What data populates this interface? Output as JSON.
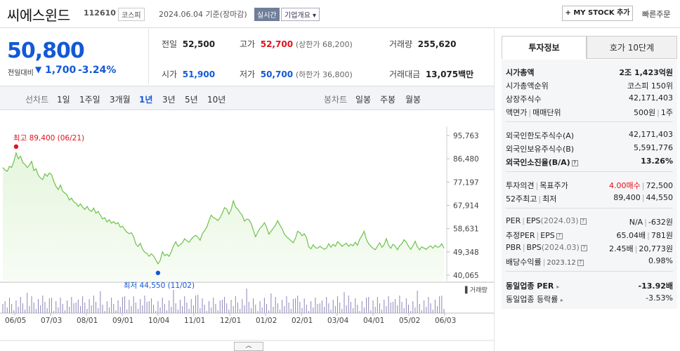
{
  "header": {
    "name": "씨에스윈드",
    "code": "112610",
    "market": "코스피",
    "date": "2024.06.04 기준(장마감)",
    "realtime": "실시간",
    "overview": "기업개요",
    "mystock": "+ MY STOCK 추가",
    "quick_order": "빠른주문"
  },
  "summary": {
    "price": "50,800",
    "diff_label": "전일대비",
    "diff_value": "1,700",
    "diff_pct": "-3.24%",
    "prev_close_label": "전일",
    "prev_close": "52,500",
    "high_label": "고가",
    "high": "52,700",
    "upper_limit": "(상한가 68,200)",
    "volume_label": "거래량",
    "volume": "255,620",
    "open_label": "시가",
    "open": "51,900",
    "low_label": "저가",
    "low": "50,700",
    "lower_limit": "(하한가 36,800)",
    "amount_label": "거래대금",
    "amount": "13,075",
    "amount_unit": "백만"
  },
  "period_bar": {
    "line_label": "선차트",
    "line_items": [
      "1일",
      "1주일",
      "3개월",
      "1년",
      "3년",
      "5년",
      "10년"
    ],
    "selected": "1년",
    "candle_label": "봉차트",
    "candle_items": [
      "일봉",
      "주봉",
      "월봉"
    ]
  },
  "chart_data": {
    "type": "area",
    "y_ticks": [
      "95,763",
      "86,480",
      "77,197",
      "67,914",
      "58,631",
      "49,348",
      "40,065"
    ],
    "ylim": [
      40065,
      95763
    ],
    "x_labels": [
      "06/05",
      "07/03",
      "08/01",
      "09/01",
      "10/04",
      "11/01",
      "12/01",
      "01/02",
      "02/01",
      "03/04",
      "04/01",
      "05/02",
      "06/03"
    ],
    "max_label": "최고 89,400 (06/21)",
    "min_label": "최저 44,550 (11/02)",
    "volume_legend": "거래량",
    "color_line": "#6cc24a",
    "color_fill": "#e6f6de",
    "series": [
      {
        "values": [
          83000,
          82000,
          81500,
          83500,
          83000,
          85500,
          88800,
          86500,
          87500,
          85000,
          84200,
          83000,
          84000,
          85500,
          81800,
          82500,
          80000,
          78800,
          78200,
          80500,
          79500,
          80800,
          80200,
          77500,
          75500,
          74200,
          76000,
          73500,
          72800,
          72000,
          70000,
          70800,
          69300,
          68800,
          67500,
          68500,
          67200,
          66300,
          67500,
          66000,
          65500,
          66800,
          64800,
          65500,
          64000,
          62500,
          63000,
          61300,
          62200,
          60800,
          61400,
          60500,
          61000,
          59200,
          59600,
          58200,
          57200,
          56600,
          57000,
          55500,
          52500,
          51500,
          52800,
          50500,
          49200,
          48800,
          47600,
          48600,
          47700,
          46200,
          44600,
          46000,
          49400,
          47800,
          48400,
          47600,
          49400,
          51800,
          53400,
          51600,
          52200,
          53000,
          54600,
          53800,
          53200,
          54400,
          55400,
          56000,
          55200,
          54000,
          56600,
          57800,
          59200,
          61800,
          64000,
          63000,
          62600,
          61800,
          63000,
          64800,
          67000,
          66400,
          64400,
          66200,
          69700,
          67200,
          66400,
          65000,
          64000,
          61600,
          62400,
          62200,
          60800,
          58000,
          55400,
          57200,
          58800,
          59600,
          61000,
          59200,
          56400,
          57600,
          58800,
          60000,
          61800,
          60000,
          58600,
          56400,
          55400,
          54600,
          53800,
          53000,
          54800,
          57600,
          57000,
          55800,
          56600,
          55000,
          51400,
          50600,
          52200,
          51000,
          50800,
          51600,
          51000,
          50400,
          50800,
          52600,
          51200,
          52400,
          51600,
          53400,
          52600,
          51600,
          52200,
          52800,
          51600,
          52400,
          51800,
          53200,
          52000,
          54400,
          55800,
          57600,
          54400,
          52600,
          51600,
          50800,
          50200,
          51600,
          53000,
          51200,
          52200,
          54600,
          52000,
          50800,
          52400,
          51600,
          50200,
          51800,
          52600,
          54200,
          53200,
          51600,
          50400,
          51800,
          53600,
          51400,
          50200,
          51400,
          50800,
          50400,
          51200,
          51800,
          50800,
          52000,
          51200,
          51400,
          52600,
          50800
        ]
      }
    ]
  },
  "right": {
    "tab_active": "투자정보",
    "tab_inactive": "호가 10단계",
    "market_cap_label": "시가총액",
    "market_cap": "2조 1,423억원",
    "rank_label": "시가총액순위",
    "rank": "코스피 150위",
    "shares_label": "상장주식수",
    "shares": "42,171,403",
    "par_label": "액면가",
    "unit_label": "매매단위",
    "par": "500원",
    "unit": "1주",
    "foreign_limit_label": "외국인한도주식수(A)",
    "foreign_limit": "42,171,403",
    "foreign_hold_label": "외국인보유주식수(B)",
    "foreign_hold": "5,591,776",
    "foreign_rate_label": "외국인소진율(B/A)",
    "foreign_rate": "13.26%",
    "opinion_label": "투자의견",
    "target_label": "목표주가",
    "opinion": "4.00매수",
    "target": "72,500",
    "w52_label": "52주최고",
    "w52_low_label": "최저",
    "w52_high": "89,400",
    "w52_low": "44,550",
    "per_label": "PER",
    "eps_label": "EPS",
    "eps_period": "(2024.03)",
    "per": "N/A",
    "eps": "-632원",
    "est_per_label": "추정PER",
    "est_eps_label": "EPS",
    "est_per": "65.04배",
    "est_eps": "781원",
    "pbr_label": "PBR",
    "bps_label": "BPS",
    "bps_period": "(2024.03)",
    "pbr": "2.45배",
    "bps": "20,773원",
    "div_label": "배당수익률",
    "div_period": "2023.12",
    "div": "0.98%",
    "ind_per_label": "동일업종 PER",
    "ind_per": "-13.92배",
    "ind_rate_label": "동일업종 등락률",
    "ind_rate": "-3.53%"
  },
  "toggle_label": "︿"
}
